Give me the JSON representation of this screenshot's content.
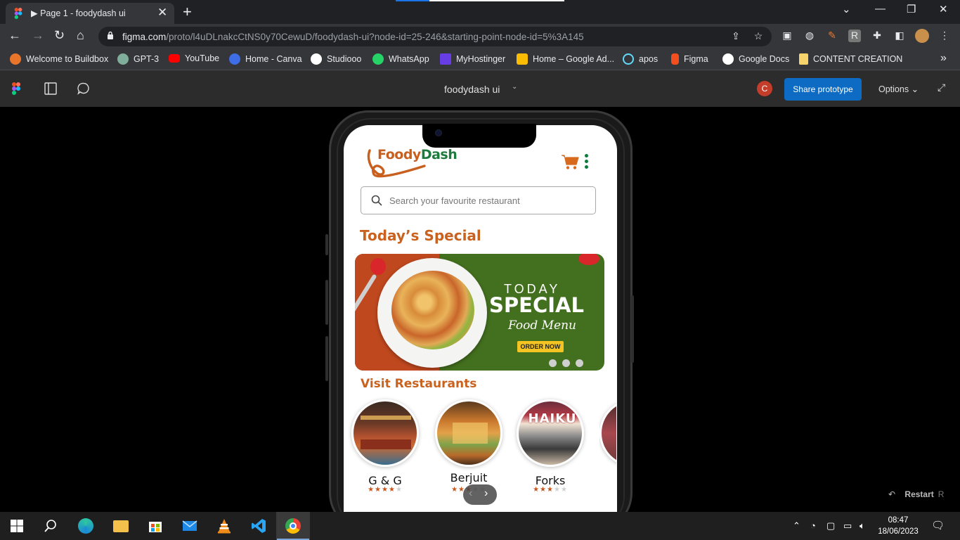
{
  "browser": {
    "tab_title": "▶ Page 1 - foodydash ui",
    "tab_close": "✕",
    "new_tab": "+",
    "url_host": "figma.com",
    "url_path": "/proto/l4uDLnakcCtNS0y70CewuD/foodydash-ui?node-id=25-246&starting-point-node-id=5%3A145",
    "bookmarks": [
      {
        "label": "Welcome to Buildbox",
        "color": "#e9752b"
      },
      {
        "label": "GPT-3",
        "color": "#7fae9c"
      },
      {
        "label": "YouTube",
        "color": "#ff0000"
      },
      {
        "label": "Home - Canva",
        "color": "#3d6ee8"
      },
      {
        "label": "Studiooo",
        "color": "#ffffff"
      },
      {
        "label": "WhatsApp",
        "color": "#25d366"
      },
      {
        "label": "MyHostinger",
        "color": "#673de6"
      },
      {
        "label": "Home – Google Ad...",
        "color": "#fbbc04"
      },
      {
        "label": "apos",
        "color": "#61dafb"
      },
      {
        "label": "Figma",
        "color": "#f24e1e"
      },
      {
        "label": "Google Docs",
        "color": "#ffffff"
      },
      {
        "label": "CONTENT CREATION",
        "color": "#f6d36b"
      }
    ],
    "more_bookmarks": "»"
  },
  "figma": {
    "file_title": "foodydash ui",
    "avatar_initial": "C",
    "share_label": "Share prototype",
    "options_label": "Options",
    "restart_label": "Restart",
    "restart_key": "R"
  },
  "app": {
    "brand_foody": "Foody",
    "brand_dash": "Dash",
    "search_placeholder": "Search your favourite restaurant",
    "today_title": "Today’s Special",
    "banner": {
      "line1": "TODAY",
      "line2": "SPECIAL",
      "line3": "Food Menu",
      "cta": "ORDER NOW",
      "slide_count": 3
    },
    "visit_title": "Visit Restaurants",
    "restaurants": [
      {
        "name": "G & G",
        "rating": 4
      },
      {
        "name": "Berjuit",
        "rating": 3
      },
      {
        "name": "Forks",
        "rating": 3
      }
    ]
  },
  "taskbar": {
    "time": "08:47",
    "date": "18/06/2023"
  },
  "colors": {
    "brand_orange": "#c9621f",
    "brand_green": "#1f7a3d",
    "share_blue": "#0d6bc4"
  }
}
